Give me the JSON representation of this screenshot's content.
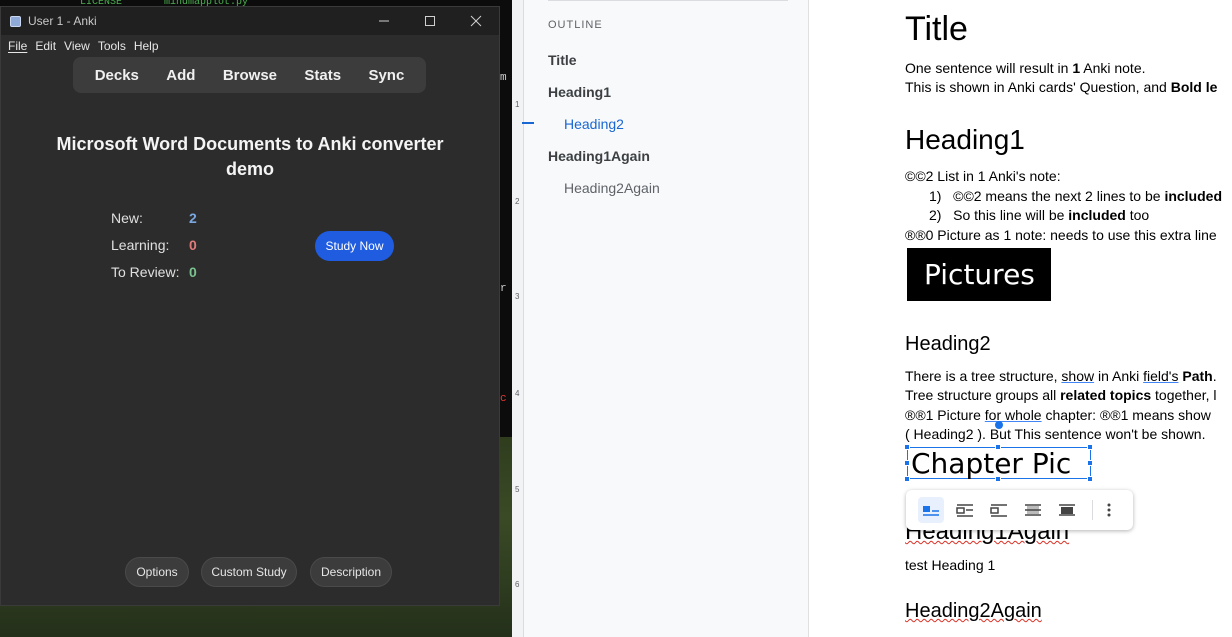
{
  "background": {
    "terminal_line": "LICENSE       mindmapplot.py",
    "marker_m": "m",
    "marker_c": "c",
    "marker_r": "r"
  },
  "anki": {
    "window_title": "User 1 - Anki",
    "window_buttons": [
      "—",
      "☐",
      "✕"
    ],
    "menu": [
      "File",
      "Edit",
      "View",
      "Tools",
      "Help"
    ],
    "toolbar": [
      "Decks",
      "Add",
      "Browse",
      "Stats",
      "Sync"
    ],
    "deck_title": "Microsoft Word Documents to Anki converter demo",
    "stats": [
      {
        "label": "New:",
        "value": "2",
        "color": "#7ba7e0"
      },
      {
        "label": "Learning:",
        "value": "0",
        "color": "#e07b7b"
      },
      {
        "label": "To Review:",
        "value": "0",
        "color": "#7bc28f"
      }
    ],
    "study_now": "Study Now",
    "bottom_buttons": [
      "Options",
      "Custom Study",
      "Description"
    ],
    "accent_color": "#1f5ce0"
  },
  "outline": {
    "heading": "OUTLINE",
    "items": [
      {
        "label": "Title",
        "level": 1
      },
      {
        "label": "Heading1",
        "level": 1
      },
      {
        "label": "Heading2",
        "level": 2,
        "active": true
      },
      {
        "label": "Heading1Again",
        "level": 1
      },
      {
        "label": "Heading2Again",
        "level": 2
      }
    ],
    "ruler_numbers": [
      "1",
      "2",
      "3",
      "4",
      "5",
      "6"
    ]
  },
  "document": {
    "title": "Title",
    "p1_a": "One sentence will result in ",
    "p1_b": "1",
    "p1_c": " Anki note.",
    "p2_a": "This is shown in Anki cards' Question, and ",
    "p2_b": "Bold le",
    "h1": "Heading1",
    "list_intro": "©©2 List in 1 Anki's note:",
    "list_1_num": "1)",
    "list_1_a": "©©2 means the next 2 lines to be ",
    "list_1_b": "included",
    "list_2_num": "2)",
    "list_2_a": "So this line will be ",
    "list_2_b": "included",
    "list_2_c": " too",
    "pic_note": "®®0 Picture as 1 note: needs to use this extra line",
    "pic1_text": "Pictures",
    "h2": "Heading2",
    "tree_a": "There is a tree structure, ",
    "tree_show": "show",
    "tree_b": " in Anki ",
    "tree_field": "field's",
    "tree_c": " ",
    "tree_path": "Path",
    "tree_d": ".",
    "groups_a": "Tree structure groups all ",
    "groups_b": "related topics",
    "groups_c": " together, l",
    "chap_a": "®®1 Picture ",
    "chap_for": "for whole",
    "chap_b": " chapter: ®®1 means show",
    "chap_c": "( Heading2 ). But This sentence won't be shown.",
    "pic2_text": "Chapter Pic",
    "h1again": "Heading1Again",
    "test_h1": "test Heading 1",
    "h2again": "Heading2Again",
    "image_toolbar_icons": [
      "inline-icon",
      "wrap-text-icon",
      "break-text-icon",
      "behind-text-icon",
      "in-front-of-text-icon",
      "more-options-icon"
    ]
  }
}
